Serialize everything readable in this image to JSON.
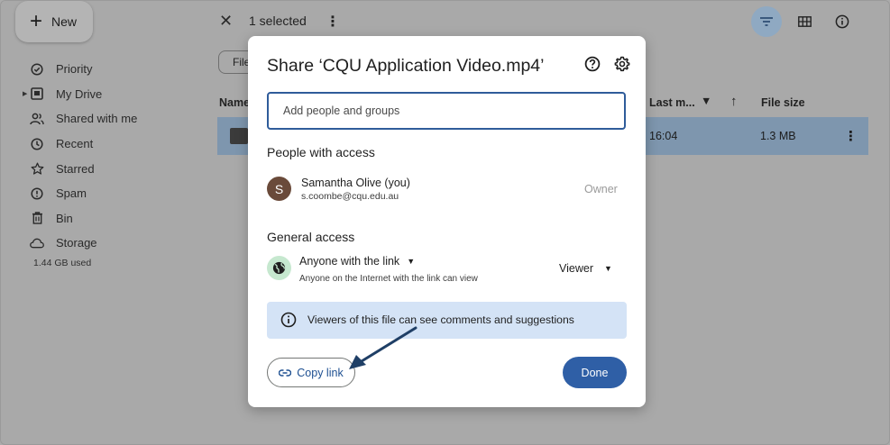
{
  "sidebar": {
    "new_label": "New",
    "items": [
      {
        "label": "Priority",
        "icon": "priority-check-icon"
      },
      {
        "label": "My Drive",
        "icon": "my-drive-icon"
      },
      {
        "label": "Shared with me",
        "icon": "shared-people-icon"
      },
      {
        "label": "Recent",
        "icon": "clock-icon"
      },
      {
        "label": "Starred",
        "icon": "star-icon"
      },
      {
        "label": "Spam",
        "icon": "spam-icon"
      },
      {
        "label": "Bin",
        "icon": "bin-icon"
      },
      {
        "label": "Storage",
        "icon": "cloud-icon"
      }
    ],
    "storage_used": "1.44 GB used"
  },
  "topbar": {
    "selection_text": "1 selected"
  },
  "file_list": {
    "filter_chip": "File",
    "columns": {
      "name": "Name",
      "last_modified": "Last m...",
      "file_size": "File size"
    },
    "rows": [
      {
        "modified": "16:04",
        "size": "1.3 MB"
      }
    ]
  },
  "dialog": {
    "title": "Share ‘CQU Application Video.mp4’",
    "add_placeholder": "Add people and groups",
    "people_heading": "People with access",
    "person": {
      "initial": "S",
      "name": "Samantha Olive (you)",
      "email": "s.coombe@cqu.edu.au",
      "role": "Owner"
    },
    "general_heading": "General access",
    "general_access": {
      "selection": "Anyone with the link",
      "description": "Anyone on the Internet with the link can view",
      "role": "Viewer"
    },
    "info_text": "Viewers of this file can see comments and suggestions",
    "copy_link_label": "Copy link",
    "done_label": "Done"
  },
  "colors": {
    "accent": "#2f5fa6",
    "info_banner": "#d4e3f6",
    "link_text": "#1d4f91",
    "annotation_arrow": "#1f3f66"
  }
}
